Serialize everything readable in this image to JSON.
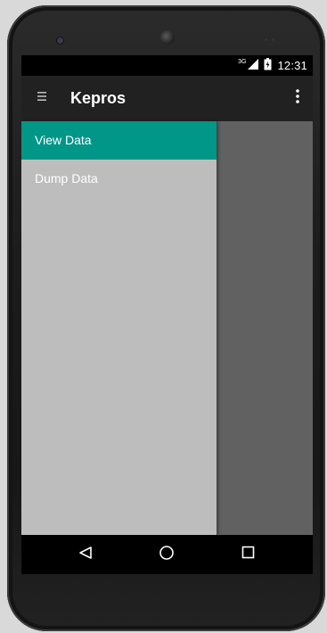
{
  "status_bar": {
    "network": "3G",
    "time": "12:31"
  },
  "app_bar": {
    "title": "Kepros",
    "menu_icon": "hamburger-menu-icon",
    "overflow_icon": "more-vert-icon"
  },
  "drawer": {
    "items": [
      {
        "label": "View Data",
        "selected": true
      },
      {
        "label": "Dump Data",
        "selected": false
      }
    ]
  },
  "nav_bar": {
    "back_icon": "back-triangle-icon",
    "home_icon": "home-circle-icon",
    "recents_icon": "recents-square-icon"
  },
  "colors": {
    "accent": "#009688",
    "app_bar": "#212121",
    "drawer_bg": "#bdbdbd",
    "scrim": "#616161"
  }
}
